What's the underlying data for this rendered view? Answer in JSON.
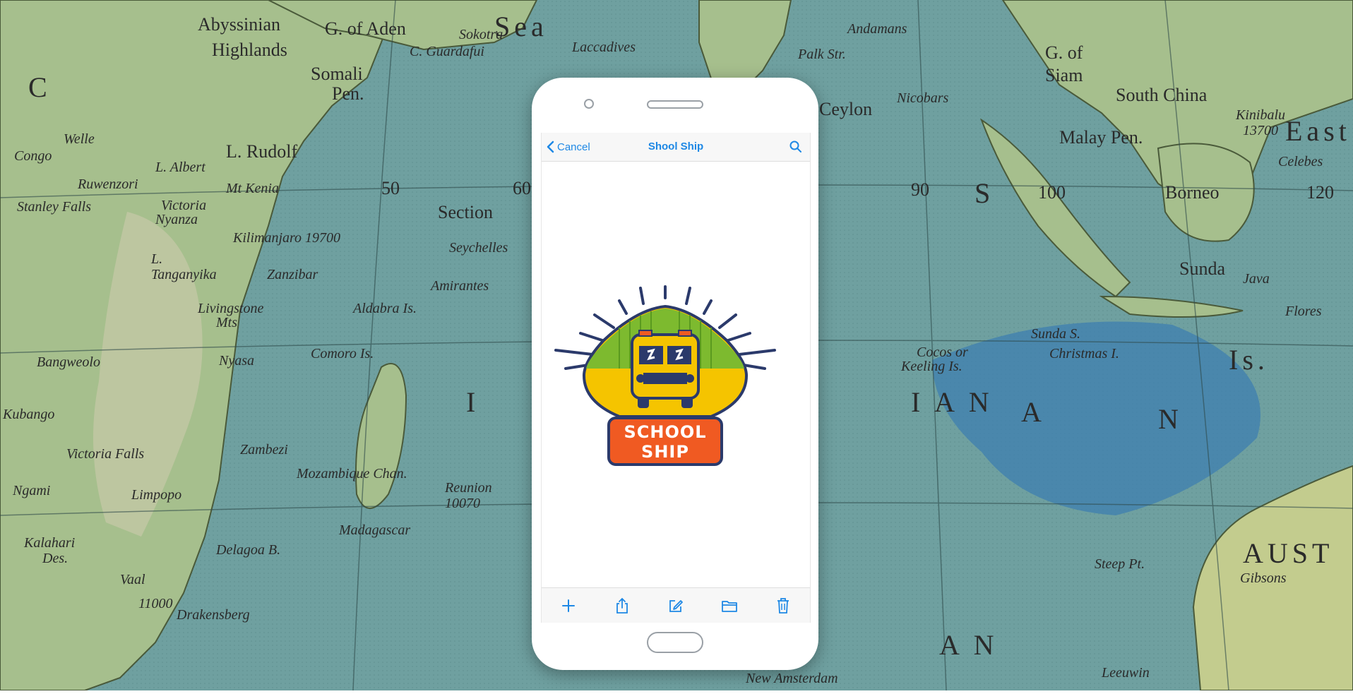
{
  "nav": {
    "back_label": "Cancel",
    "title": "Shool Ship",
    "search_icon": "search-icon"
  },
  "logo": {
    "line1": "SCHOOL",
    "line2": "SHIP"
  },
  "toolbar": {
    "items": [
      {
        "name": "add",
        "icon": "plus-icon"
      },
      {
        "name": "share",
        "icon": "share-icon"
      },
      {
        "name": "edit",
        "icon": "compose-icon"
      },
      {
        "name": "folder",
        "icon": "folder-icon"
      },
      {
        "name": "delete",
        "icon": "trash-icon"
      }
    ]
  },
  "map_labels": [
    "Abyssinian",
    "Highlands",
    "G. of Aden",
    "Sokotra",
    "C. Guardafui",
    "Sea",
    "Laccadives",
    "Andamans",
    "Palk Str.",
    "G. of",
    "Siam",
    "South China",
    "Somali",
    "Pen.",
    "L. Rudolf",
    "Ceylon",
    "Nicobars",
    "Malay Pen.",
    "Kinibalu",
    "13700",
    "Celebes",
    "East",
    "Congo",
    "Welle",
    "L. Albert",
    "Ruwenzori",
    "Mt Kenia",
    "Victoria",
    "Nyanza",
    "Stanley Falls",
    "Kilimanjaro 19700",
    "50",
    "60",
    "90",
    "100",
    "120",
    "Section",
    "Seychelles",
    "Borneo",
    "Amirantes",
    "L.",
    "Tanganyika",
    "Zanzibar",
    "Livingstone",
    "Mts",
    "Aldabra Is.",
    "Sunda",
    "Java",
    "Flores",
    "Comoro Is.",
    "Bangweolo",
    "Nyasa",
    "Cocos or",
    "Keeling Is.",
    "Christmas I.",
    "Sunda S.",
    "Is.",
    "Kubango",
    "Victoria Falls",
    "Zambezi",
    "Ngami",
    "Kalahari",
    "Des.",
    "Limpopo",
    "Mozambique Chan.",
    "Madagascar",
    "Reunion",
    "10070",
    "Delagoa B.",
    "Vaal",
    "11000",
    "Drakensberg",
    "Steep Pt.",
    "AUST",
    "Gibsons",
    "New Amsterdam",
    "Leeuwin",
    "I",
    "A",
    "N",
    "C",
    "I A N",
    "S",
    "A N"
  ],
  "colors": {
    "accent": "#1e88e5",
    "ocean": "#6fa0a0",
    "land": "#9fb98a",
    "deep_sea": "#3d7fb0",
    "logo_yellow": "#f5c400",
    "logo_green": "#7dba2f",
    "logo_orange": "#f05a22",
    "logo_navy": "#2b3a6b"
  }
}
